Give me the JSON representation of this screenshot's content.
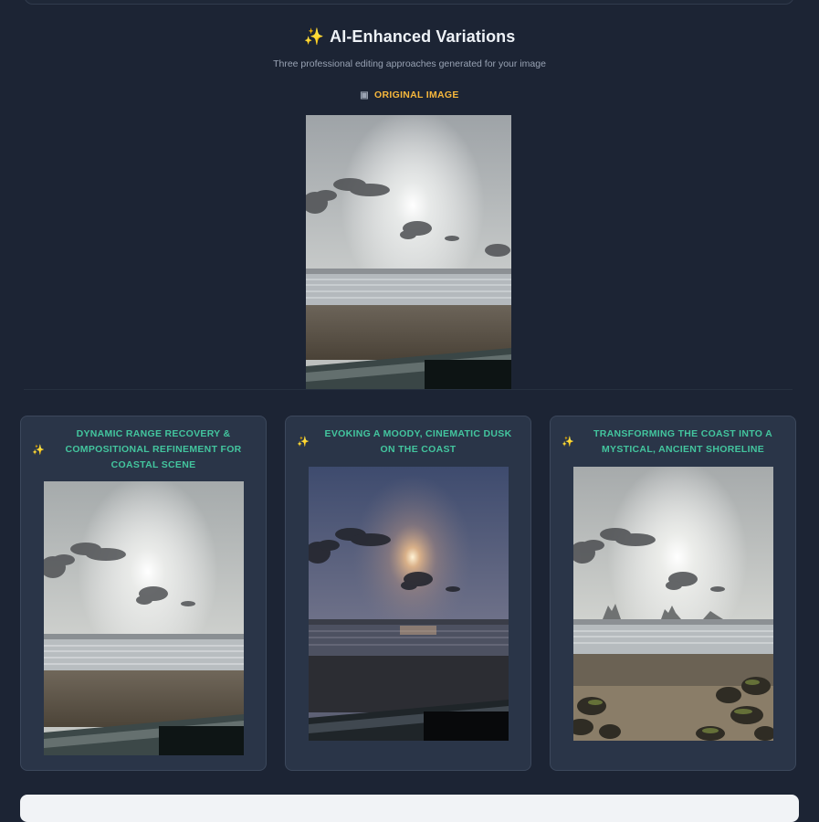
{
  "header": {
    "spark_icon": "sparkles-icon",
    "title": "AI-Enhanced Variations",
    "subtitle": "Three professional editing approaches generated for your image"
  },
  "original": {
    "icon": "camera-icon",
    "label": "ORIGINAL IMAGE"
  },
  "variations": [
    {
      "title": "DYNAMIC RANGE RECOVERY & COMPOSITIONAL REFINEMENT FOR COASTAL SCENE",
      "icon": "sparkles-icon"
    },
    {
      "title": "EVOKING A MOODY, CINEMATIC DUSK ON THE COAST",
      "icon": "sparkles-icon"
    },
    {
      "title": "TRANSFORMING THE COAST INTO A MYSTICAL, ANCIENT SHORELINE",
      "icon": "sparkles-icon"
    }
  ],
  "colors": {
    "background": "#1c2434",
    "card": "#2a3548",
    "accent_orange": "#f6b73c",
    "accent_green": "#43c59e"
  }
}
